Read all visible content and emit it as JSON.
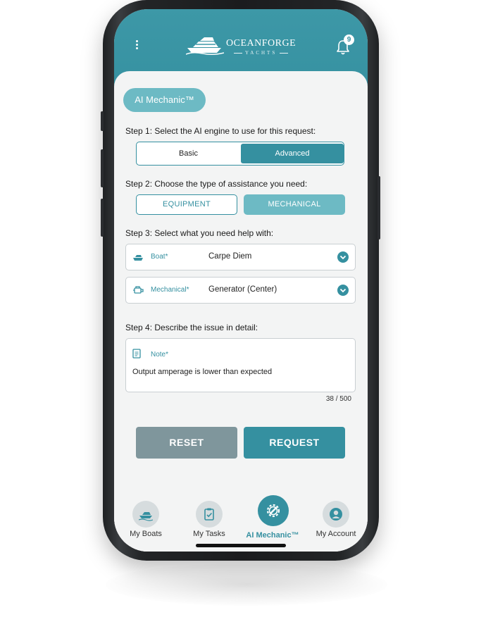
{
  "app": {
    "brand_name": "OCEANFORGE",
    "brand_sub": "YACHTS",
    "notification_count": "9"
  },
  "colors": {
    "primary": "#3590a0",
    "light_primary": "#6dbac4",
    "reset_button": "#7f969c",
    "background": "#f3f4f4"
  },
  "page": {
    "title": "AI Mechanic™"
  },
  "step1": {
    "label": "Step 1: Select the AI engine to use for this request:",
    "options": [
      "Basic",
      "Advanced"
    ],
    "selected": "Advanced"
  },
  "step2": {
    "label": "Step 2: Choose the type of assistance you need:",
    "options": [
      "EQUIPMENT",
      "MECHANICAL"
    ],
    "selected": "MECHANICAL"
  },
  "step3": {
    "label": "Step 3: Select what you need help with:",
    "boat": {
      "label": "Boat*",
      "value": "Carpe Diem",
      "icon": "boat-icon"
    },
    "mechanical": {
      "label": "Mechanical*",
      "value": "Generator (Center)",
      "icon": "engine-icon"
    }
  },
  "step4": {
    "label": "Step 4: Describe the issue in detail:",
    "note_label": "Note*",
    "note_value": "Output amperage is lower than expected",
    "counter": "38 / 500"
  },
  "actions": {
    "reset": "RESET",
    "request": "REQUEST"
  },
  "tabs": [
    {
      "label": "My Boats",
      "icon": "boat-icon"
    },
    {
      "label": "My Tasks",
      "icon": "clipboard-icon"
    },
    {
      "label": "AI Mechanic™",
      "icon": "wrench-gear-icon",
      "active": true
    },
    {
      "label": "My Account",
      "icon": "person-icon"
    }
  ]
}
